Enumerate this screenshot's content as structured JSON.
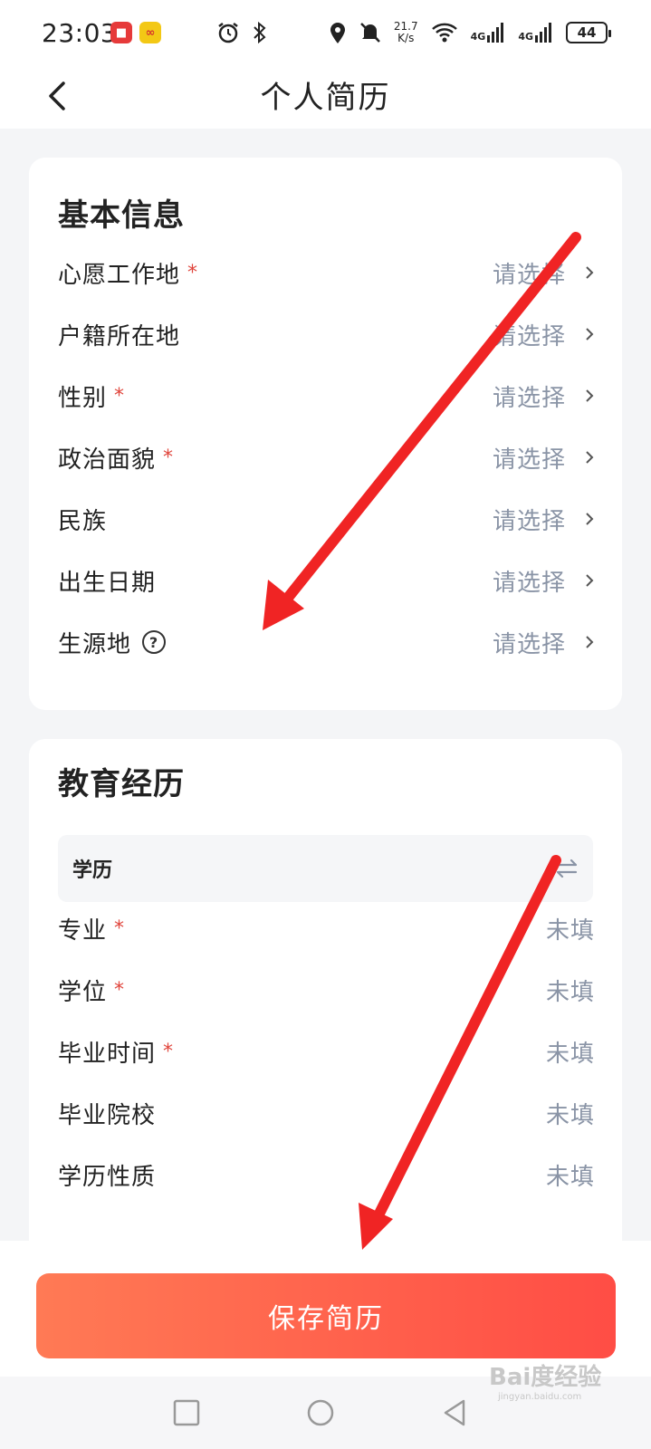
{
  "status_bar": {
    "time": "23:03",
    "speed_value": "21.7",
    "speed_unit": "K/s",
    "net1": "4G",
    "net2": "4G",
    "battery": "44"
  },
  "header": {
    "title": "个人简历"
  },
  "basic_info": {
    "title": "基本信息",
    "rows": [
      {
        "label": "心愿工作地",
        "required": true,
        "value": "请选择"
      },
      {
        "label": "户籍所在地",
        "required": false,
        "value": "请选择"
      },
      {
        "label": "性别",
        "required": true,
        "value": "请选择"
      },
      {
        "label": "政治面貌",
        "required": true,
        "value": "请选择"
      },
      {
        "label": "民族",
        "required": false,
        "value": "请选择"
      },
      {
        "label": "出生日期",
        "required": false,
        "value": "请选择"
      },
      {
        "label": "生源地",
        "required": false,
        "value": "请选择"
      }
    ]
  },
  "education": {
    "title": "教育经历",
    "degree_label": "学历",
    "rows": [
      {
        "label": "专业",
        "required": true,
        "value": "未填"
      },
      {
        "label": "学位",
        "required": true,
        "value": "未填"
      },
      {
        "label": "毕业时间",
        "required": true,
        "value": "未填"
      },
      {
        "label": "毕业院校",
        "required": false,
        "value": "未填"
      },
      {
        "label": "学历性质",
        "required": false,
        "value": "未填"
      }
    ]
  },
  "required_mark": "*",
  "help_mark": "?",
  "save_button": "保存简历",
  "watermark": {
    "brand": "Bai度经验",
    "url": "jingyan.baidu.com"
  },
  "colors": {
    "accent_start": "#ff7a55",
    "accent_end": "#ff4d45",
    "required": "#e0453c",
    "placeholder": "#8a94a6",
    "annotation_arrow": "#f02424"
  }
}
